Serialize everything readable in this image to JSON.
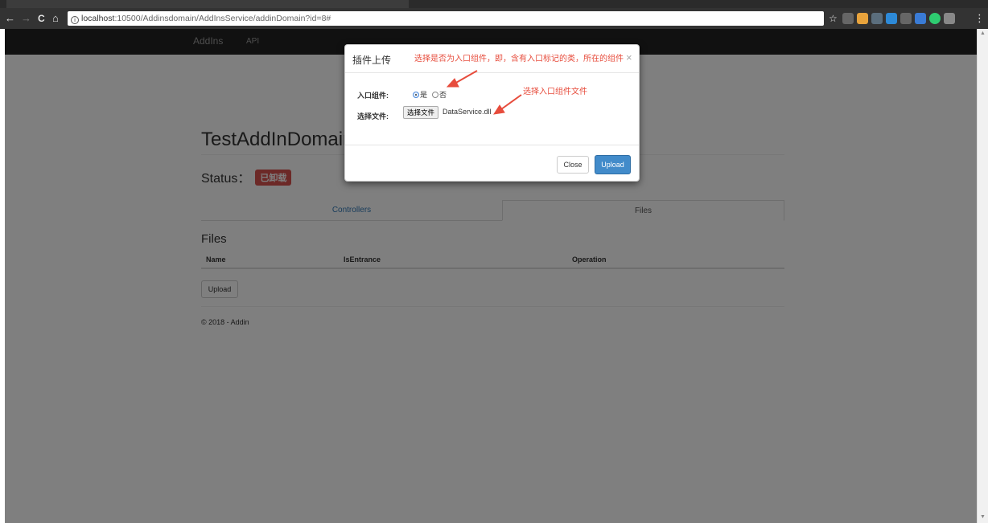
{
  "browser": {
    "back_icon": "←",
    "forward_icon": "→",
    "reload_icon": "C",
    "home_icon": "⌂",
    "info_icon": "i",
    "url_host": "localhost",
    "url_rest": ":10500/Addinsdomain/AddInsService/addinDomain?id=8#",
    "star_icon": "☆",
    "menu_icon": "⋮"
  },
  "navbar": {
    "brand": "AddIns",
    "link_api": "API"
  },
  "page": {
    "title": "TestAddInDomain",
    "status_label": "Status：",
    "status_badge": "已卸载",
    "tabs": [
      "Controllers",
      "Files"
    ],
    "files_heading": "Files",
    "columns": [
      "Name",
      "IsEntrance",
      "Operation"
    ],
    "upload_label": "Upload",
    "footer": "© 2018 - Addin"
  },
  "modal": {
    "title": "插件上传",
    "close_glyph": "×",
    "annotation_entrance": "选择是否为入口组件，即，含有入口标记的类，所在的组件",
    "annotation_file": "选择入口组件文件",
    "label_entrance": "入口组件:",
    "radio_yes": "是",
    "radio_no": "否",
    "label_file": "选择文件:",
    "file_button": "选择文件",
    "file_name": "DataService.dll",
    "close_label": "Close",
    "upload_label": "Upload"
  },
  "colors": {
    "annotation": "#e74c3c",
    "primary": "#428bca",
    "danger": "#d9534f",
    "navbar": "#222222"
  }
}
